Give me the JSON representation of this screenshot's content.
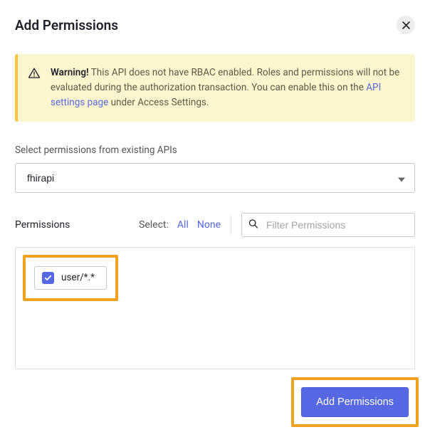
{
  "header": {
    "title": "Add Permissions"
  },
  "warning": {
    "strong": "Warning!",
    "text_before_link": " This API does not have RBAC enabled. Roles and permissions will not be evaluated during the authorization transaction. You can enable this on the ",
    "link_text": "API settings page",
    "text_after_link": " under Access Settings."
  },
  "api_select": {
    "label": "Select permissions from existing APIs",
    "value": "fhirapi"
  },
  "permissions": {
    "label": "Permissions",
    "select_label": "Select:",
    "all_label": "All",
    "none_label": "None",
    "filter_placeholder": "Filter Permissions",
    "items": [
      {
        "name": "user/*.*",
        "checked": true
      }
    ]
  },
  "footer": {
    "submit_label": "Add Permissions"
  }
}
